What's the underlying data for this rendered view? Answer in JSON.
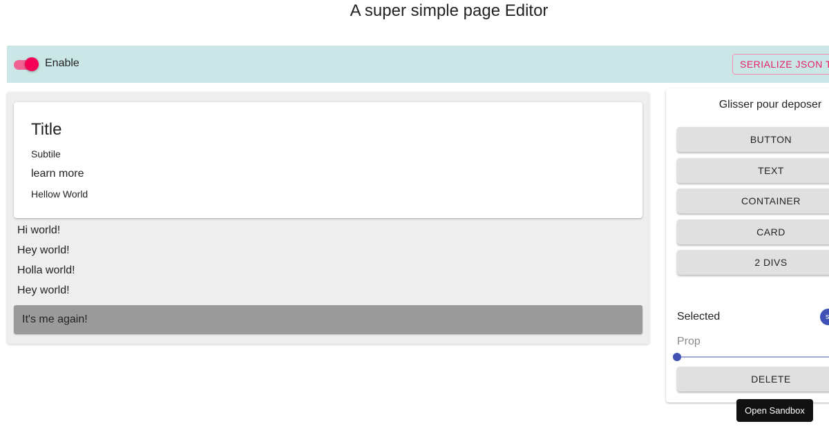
{
  "page": {
    "title": "A super simple page Editor"
  },
  "toolbar": {
    "enable_label": "Enable",
    "enable_on": true,
    "serialize_label": "SERIALIZE JSON TO",
    "background": "#cbe6e6"
  },
  "canvas": {
    "card": {
      "title": "Title",
      "subtitle": "Subtile",
      "link": "learn more",
      "body": "Hellow World"
    },
    "texts": [
      "Hi world!",
      "Hey world!",
      "Holla world!",
      "Hey world!"
    ],
    "container_text": "It's me again!"
  },
  "panel": {
    "heading": "Glisser pour deposer",
    "tools": [
      "BUTTON",
      "TEXT",
      "CONTAINER",
      "CARD",
      "2 DIVS"
    ],
    "selected_label": "Selected",
    "selected_chip": "s",
    "prop_label": "Prop",
    "prop_value": 0,
    "delete_label": "DELETE"
  },
  "tooltip": {
    "text": "Open Sandbox"
  },
  "colors": {
    "accent_pink": "#f50057",
    "primary_indigo": "#3f51b5"
  }
}
